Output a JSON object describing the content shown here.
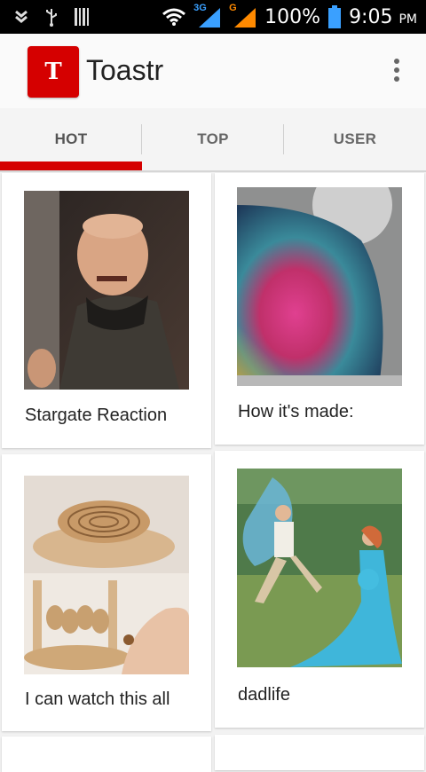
{
  "status_bar": {
    "network_3g": "3G",
    "network_g": "G",
    "battery": "100%",
    "time": "9:05",
    "ampm": "PM",
    "left_icons": [
      "shield-icon",
      "usb-icon",
      "barcode-icon"
    ],
    "right_icons": [
      "wifi-icon",
      "signal-icon",
      "signal-icon",
      "battery-icon"
    ]
  },
  "app_bar": {
    "logo_letter": "T",
    "title": "Toastr",
    "menu_icon": "more-vert-icon"
  },
  "tabs": [
    {
      "label": "HOT",
      "selected": true
    },
    {
      "label": "TOP",
      "selected": false
    },
    {
      "label": "USER",
      "selected": false
    }
  ],
  "colors": {
    "accent": "#d50000",
    "status_bar": "#000000",
    "background": "#f2f2f2",
    "card": "#ffffff",
    "tab_text": "#666666"
  },
  "cards": [
    {
      "caption": "Stargate Reaction",
      "thumbnail": "laughing-man-image"
    },
    {
      "caption": "How it's made:",
      "thumbnail": "iridescent-glass-image"
    },
    {
      "caption": "I can watch this all",
      "thumbnail": "wooden-mechanism-image"
    },
    {
      "caption": "dadlife",
      "thumbnail": "maternity-photo-image"
    }
  ]
}
